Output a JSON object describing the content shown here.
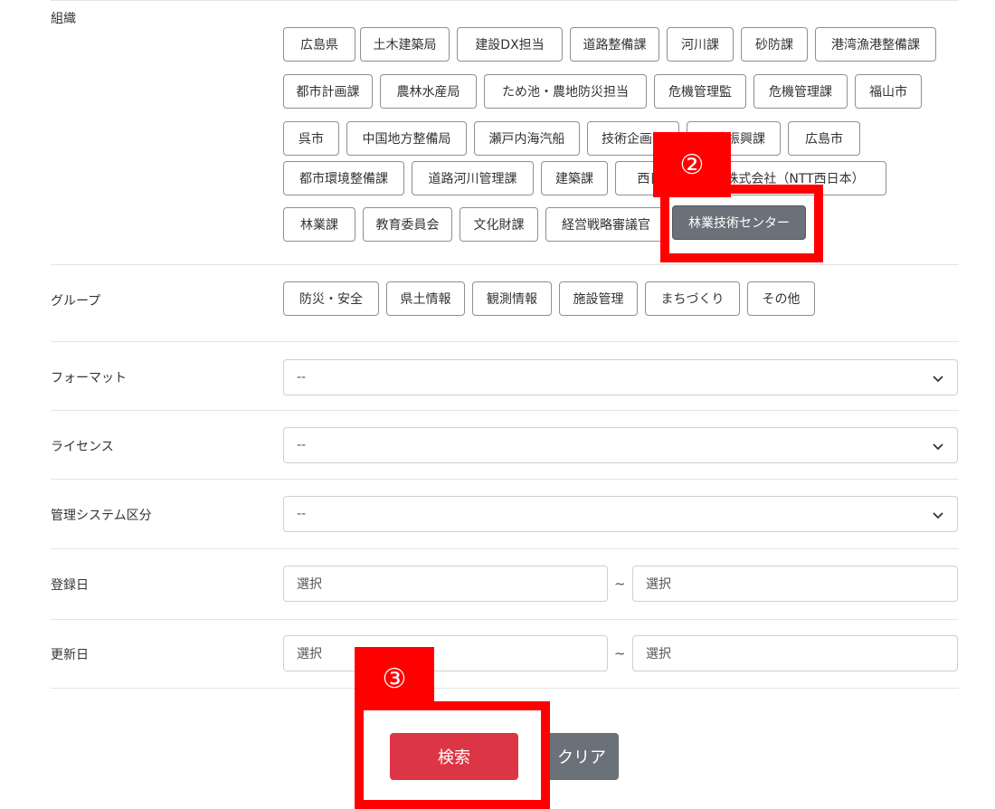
{
  "labels": {
    "organization": "組織",
    "group": "グループ",
    "format": "フォーマット",
    "license": "ライセンス",
    "management": "管理システム区分",
    "registered": "登録日",
    "updated": "更新日"
  },
  "organizations": [
    "広島県",
    "土木建築局",
    "建設DX担当",
    "道路整備課",
    "河川課",
    "砂防課",
    "港湾漁港整備課",
    "都市計画課",
    "農林水産局",
    "ため池・農地防災担当",
    "危機管理監",
    "危機管理課",
    "福山市",
    "呉市",
    "中国地方整備局",
    "瀬戸内海汽船",
    "技術企画課",
    "港湾振興課",
    "広島市",
    "都市環境整備課",
    "道路河川管理課",
    "建築課",
    "西日本電信電話株式会社（NTT西日本）",
    "林業課",
    "教育委員会",
    "文化財課",
    "経営戦略審議官",
    "林業技術センター"
  ],
  "selected_organization": "林業技術センター",
  "groups": [
    "防災・安全",
    "県土情報",
    "観測情報",
    "施設管理",
    "まちづくり",
    "その他"
  ],
  "selects": {
    "format": "--",
    "license": "--",
    "management": "--"
  },
  "date_placeholder": "選択",
  "range_separator": "~",
  "buttons": {
    "search": "検索",
    "clear": "クリア"
  },
  "annotations": {
    "step2": "②",
    "step3": "③"
  },
  "colors": {
    "annotation_red": "#ff0000",
    "search_button": "#dc3545",
    "selected_tag": "#6b7178"
  }
}
